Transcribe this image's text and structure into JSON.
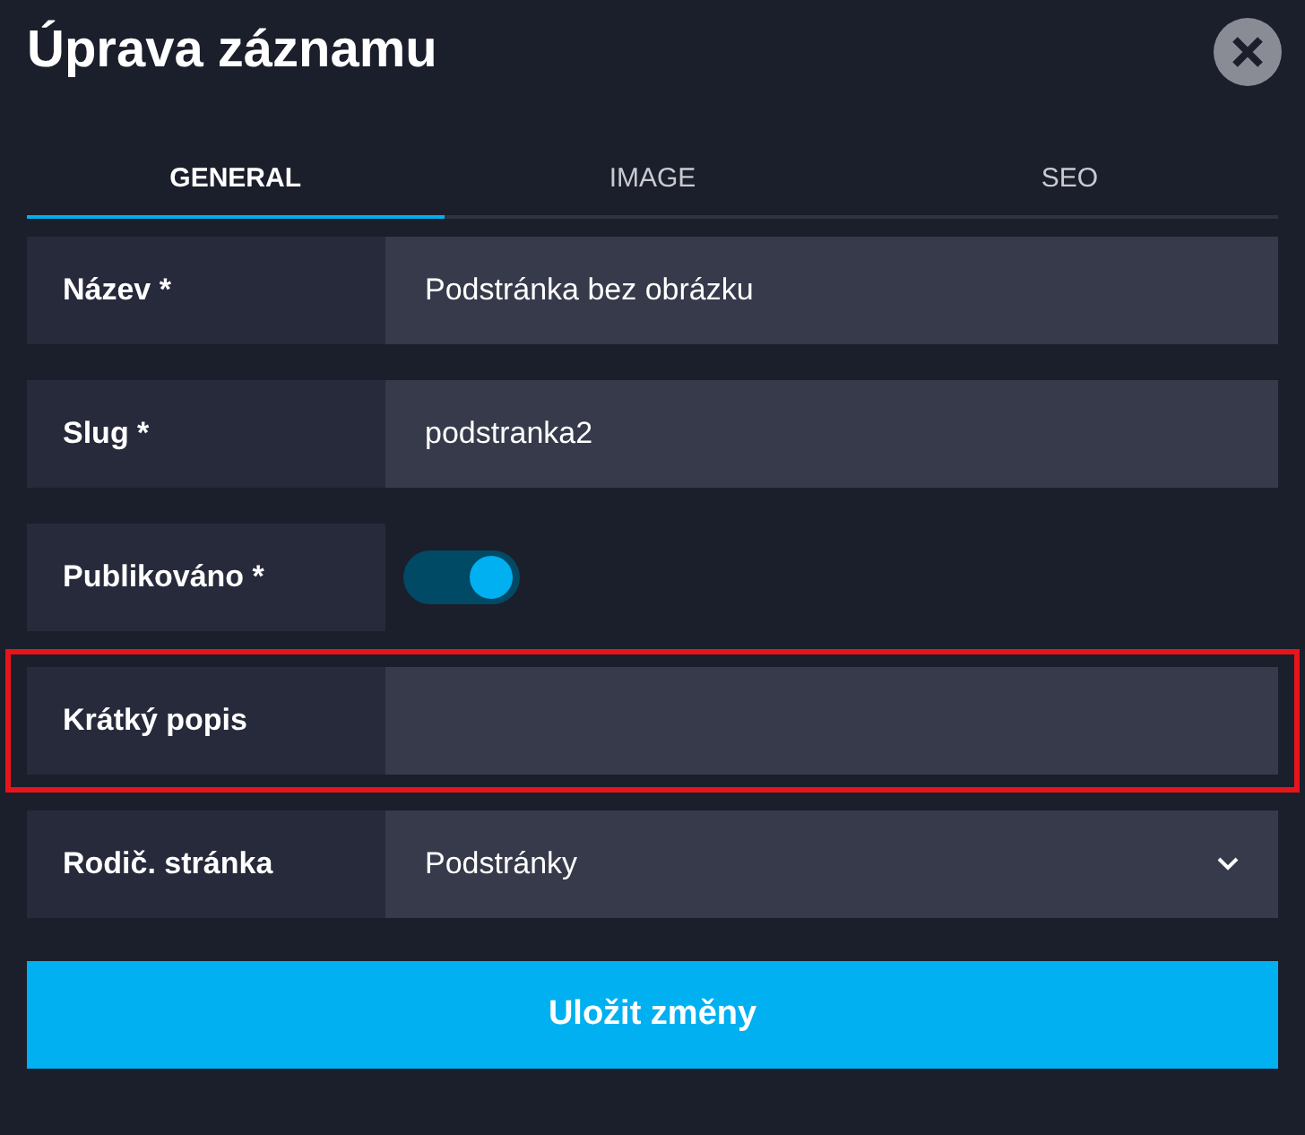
{
  "dialog": {
    "title": "Úprava záznamu"
  },
  "tabs": [
    {
      "label": "GENERAL",
      "selected": true
    },
    {
      "label": "IMAGE",
      "selected": false
    },
    {
      "label": "SEO",
      "selected": false
    }
  ],
  "fields": [
    {
      "kind": "text",
      "label": "Název *",
      "value": "Podstránka bez obrázku",
      "highlighted": false
    },
    {
      "kind": "text",
      "label": "Slug *",
      "value": "podstranka2",
      "highlighted": false
    },
    {
      "kind": "toggle",
      "label": "Publikováno *",
      "on": true,
      "highlighted": false
    },
    {
      "kind": "text",
      "label": "Krátký popis",
      "highlighted": true
    },
    {
      "kind": "select",
      "label": "Rodič. stránka",
      "value": "Podstránky",
      "highlighted": false
    }
  ],
  "save_button": "Uložit změny"
}
